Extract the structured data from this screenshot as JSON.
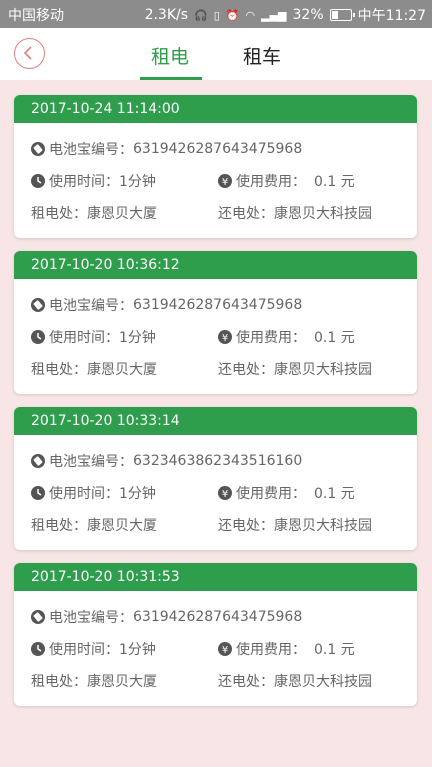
{
  "status_bar": {
    "carrier": "中国移动",
    "speed": "2.3K/s",
    "battery": "32%",
    "time": "中午11:27"
  },
  "header": {
    "tabs": [
      {
        "label": "租电",
        "active": true
      },
      {
        "label": "租车",
        "active": false
      }
    ]
  },
  "labels": {
    "battery_id": "电池宝编号：",
    "use_time": "使用时间：",
    "use_fee": "使用费用：",
    "rent_place": "租电处：",
    "return_place": "还电处："
  },
  "colors": {
    "accent": "#2e9e4c",
    "back_border": "#e0807f",
    "background": "#f8e6e6"
  },
  "records": [
    {
      "datetime": "2017-10-24 11:14:00",
      "battery_id": "6319426287643475968",
      "use_time": "1分钟",
      "fee": "0.1 元",
      "rent_place": "康恩贝大厦",
      "return_place": "康恩贝大科技园"
    },
    {
      "datetime": "2017-10-20 10:36:12",
      "battery_id": "6319426287643475968",
      "use_time": "1分钟",
      "fee": "0.1 元",
      "rent_place": "康恩贝大厦",
      "return_place": "康恩贝大科技园"
    },
    {
      "datetime": "2017-10-20 10:33:14",
      "battery_id": "6323463862343516160",
      "use_time": "1分钟",
      "fee": "0.1 元",
      "rent_place": "康恩贝大厦",
      "return_place": "康恩贝大科技园"
    },
    {
      "datetime": "2017-10-20 10:31:53",
      "battery_id": "6319426287643475968",
      "use_time": "1分钟",
      "fee": "0.1 元",
      "rent_place": "康恩贝大厦",
      "return_place": "康恩贝大科技园"
    }
  ]
}
